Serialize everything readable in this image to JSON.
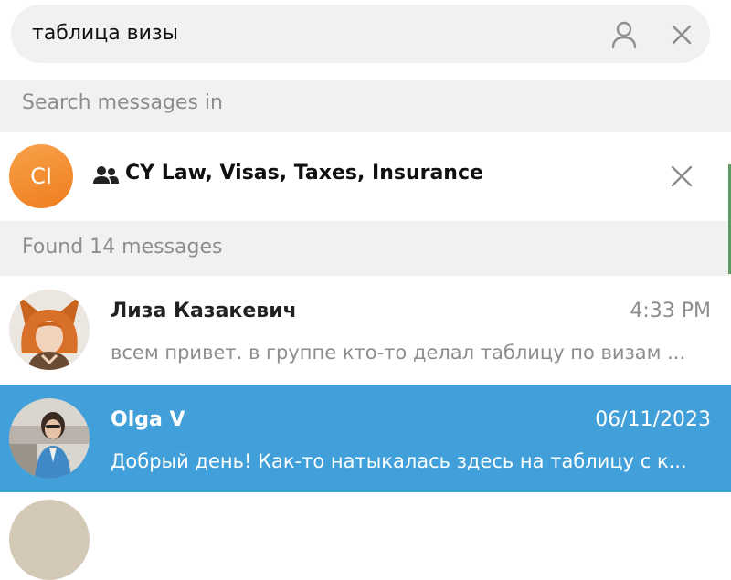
{
  "search": {
    "query": "таблица визы"
  },
  "sections": {
    "search_in": "Search messages in",
    "found": "Found 14 messages"
  },
  "chat_filter": {
    "initials": "CI",
    "name": "CY Law, Visas, Taxes, Insurance",
    "avatar_color": "#f39232"
  },
  "results": [
    {
      "name": "Лиза Казакевич",
      "time": "4:33 PM",
      "preview": "всем привет. в группе кто-то делал таблицу по визам ...",
      "selected": false
    },
    {
      "name": "Olga V",
      "time": "06/11/2023",
      "preview": "Добрый день! Как-то натыкалась здесь на таблицу с к...",
      "selected": true
    }
  ],
  "colors": {
    "accent": "#419fd9",
    "header_bg": "#f1f1f1",
    "muted_text": "#8d8d8d"
  },
  "icons": {
    "search_user": "user-icon",
    "search_clear": "close-icon",
    "chat_type": "group-icon",
    "chat_filter_clear": "close-icon"
  }
}
